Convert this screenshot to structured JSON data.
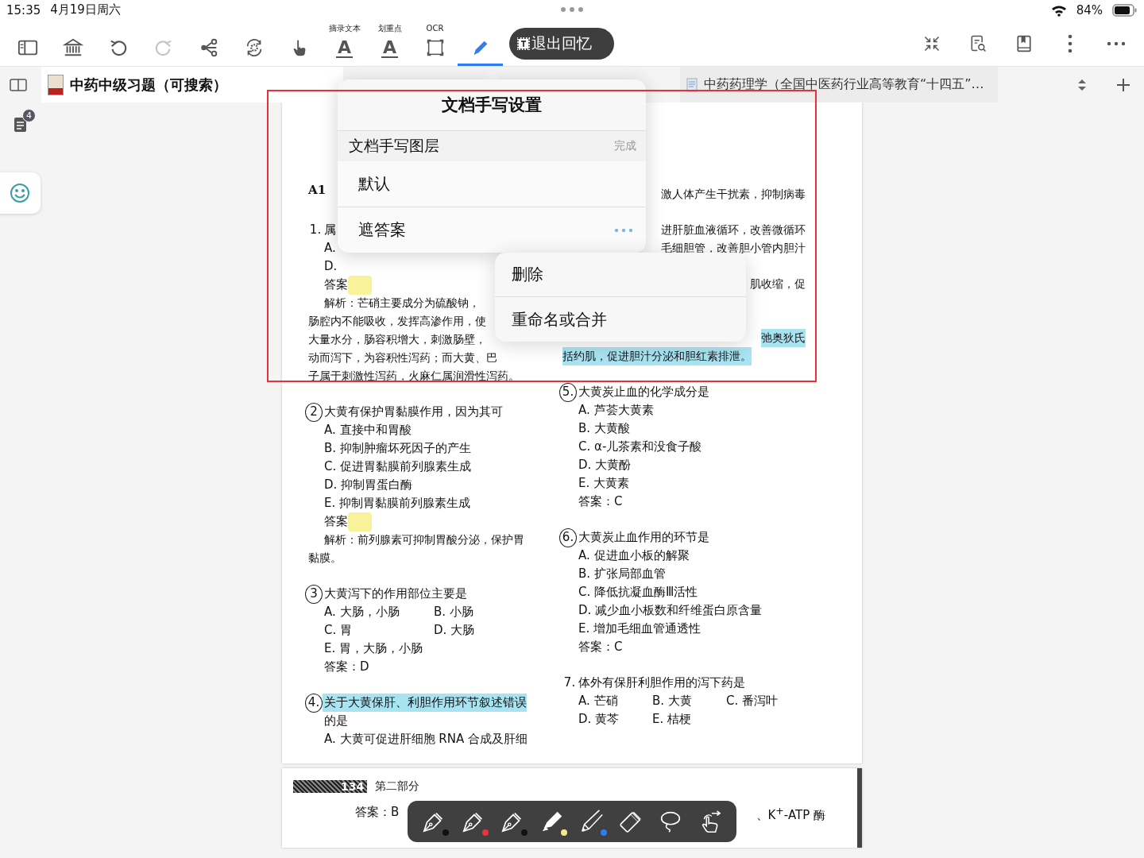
{
  "status_bar": {
    "time": "15:35",
    "date": "4月19日周六",
    "battery": "84%"
  },
  "toolbar": {
    "tools": [
      {
        "kind": "sidebar",
        "selected": false,
        "disabled": false
      },
      {
        "kind": "library",
        "selected": false,
        "disabled": false
      },
      {
        "kind": "undo",
        "selected": false,
        "disabled": false
      },
      {
        "kind": "redo",
        "selected": false,
        "disabled": true
      },
      {
        "kind": "share",
        "selected": false,
        "disabled": false
      },
      {
        "kind": "rotate",
        "selected": false,
        "disabled": false
      },
      {
        "kind": "hand",
        "selected": false,
        "disabled": false
      },
      {
        "kind": "letter",
        "label": "摘录文本",
        "glyph": "A",
        "selected": false,
        "disabled": false
      },
      {
        "kind": "letter",
        "label": "划重点",
        "glyph": "A",
        "selected": false,
        "disabled": false
      },
      {
        "kind": "scan",
        "label": "OCR",
        "selected": false,
        "disabled": false
      },
      {
        "kind": "pencil",
        "selected": true,
        "disabled": false
      }
    ],
    "exit_button": "退出回忆",
    "right_tools": [
      {
        "kind": "collapse"
      },
      {
        "kind": "doc-search"
      },
      {
        "kind": "bookmark"
      },
      {
        "kind": "kebab"
      },
      {
        "kind": "more"
      }
    ]
  },
  "tabs": [
    {
      "title": "中药中级习题（可搜索）",
      "selected": true
    },
    {
      "title": "中药药理学（全国中医药行业高等教育“十四五”…",
      "selected": false
    }
  ],
  "notes_badge": "4",
  "popup": {
    "title": "文档手写设置",
    "header": "文档手写图层",
    "done": "完成",
    "layers": [
      "默认",
      "遮答案"
    ]
  },
  "context_menu": [
    "删除",
    "重命名或合并"
  ],
  "document": {
    "left": [
      {
        "lines": [
          {
            "kind": "section",
            "text": "A1"
          }
        ]
      },
      {
        "lines": [
          {
            "kind": "stem",
            "number": "1.",
            "text": "属",
            "circled": false,
            "highlighted": false
          },
          {
            "kind": "option",
            "text": "A."
          },
          {
            "kind": "option",
            "text": "D."
          },
          {
            "kind": "answer",
            "text": "答案",
            "masked": true
          },
          {
            "kind": "analysis",
            "text": "解析：芒硝主要成分为硫酸钠，"
          },
          {
            "kind": "cont",
            "text": "肠腔内不能吸收，发挥高渗作用，使"
          },
          {
            "kind": "cont",
            "text": "大量水分，肠容积增大，刺激肠壁，"
          },
          {
            "kind": "cont",
            "text": "动而泻下，为容积性泻药；而大黄、巴"
          },
          {
            "kind": "cont",
            "text": "子属于刺激性泻药，火麻仁属润滑性泻药。"
          }
        ]
      },
      {
        "lines": [
          {
            "kind": "stem",
            "number": "2",
            "text": "大黄有保护胃黏膜作用，因为其可",
            "circled": true,
            "highlighted": false
          },
          {
            "kind": "option",
            "text": "A. 直接中和胃酸"
          },
          {
            "kind": "option",
            "text": "B. 抑制肿瘤坏死因子的产生"
          },
          {
            "kind": "option",
            "text": "C. 促进胃黏膜前列腺素生成"
          },
          {
            "kind": "option",
            "text": "D. 抑制胃蛋白酶"
          },
          {
            "kind": "option",
            "text": "E. 抑制胃黏膜前列腺素生成"
          },
          {
            "kind": "answer",
            "text": "答案",
            "masked": true
          },
          {
            "kind": "analysis",
            "text": "解析：前列腺素可抑制胃酸分泌，保护胃"
          },
          {
            "kind": "cont",
            "text": "黏膜。"
          }
        ]
      },
      {
        "lines": [
          {
            "kind": "stem",
            "number": "3",
            "text": "大黄泻下的作用部位主要是",
            "circled": true,
            "highlighted": false
          },
          {
            "kind": "row",
            "items": [
              "A. 大肠，小肠",
              "B. 小肠"
            ]
          },
          {
            "kind": "row",
            "items": [
              "C. 胃",
              "D. 大肠"
            ]
          },
          {
            "kind": "option",
            "text": "E. 胃，大肠，小肠"
          },
          {
            "kind": "answer",
            "text": "答案：D",
            "masked": false
          }
        ]
      },
      {
        "lines": [
          {
            "kind": "stem",
            "number": "4.",
            "text": "关于大黄保肝、利胆作用环节叙述错误",
            "circled": true,
            "highlighted": true
          },
          {
            "kind": "option",
            "text": "的是"
          },
          {
            "kind": "option",
            "text": "A. 大黄可促进肝细胞 RNA 合成及肝细"
          }
        ]
      }
    ],
    "right": [
      {
        "lines": [
          {
            "kind": "tail",
            "text": "激人体产生干扰素，抑制病毒",
            "highlighted": false
          }
        ]
      },
      {
        "lines": [
          {
            "kind": "tail",
            "text": "进肝脏血液循环，改善微循环",
            "highlighted": false
          },
          {
            "kind": "tail",
            "text": "毛细胆管，改善胆小管内胆汁",
            "highlighted": false
          }
        ]
      },
      {
        "lines": [
          {
            "kind": "tail",
            "text": "肌收缩，促",
            "highlighted": false
          }
        ]
      },
      {
        "lines": [
          {
            "kind": "tail",
            "text": "弛奥狄氏",
            "highlighted": true
          },
          {
            "kind": "cont",
            "text": "括约肌，促进胆汁分泌和胆红素排泄。",
            "highlighted": true
          }
        ]
      },
      {
        "lines": [
          {
            "kind": "stem",
            "number": "5.",
            "text": "大黄炭止血的化学成分是",
            "circled": true,
            "highlighted": false
          },
          {
            "kind": "option",
            "text": "A. 芦荟大黄素"
          },
          {
            "kind": "option",
            "text": "B. 大黄酸"
          },
          {
            "kind": "option",
            "text": "C. α-儿茶素和没食子酸"
          },
          {
            "kind": "option",
            "text": "D. 大黄酚"
          },
          {
            "kind": "option",
            "text": "E. 大黄素"
          },
          {
            "kind": "answer",
            "text": "答案：C",
            "masked": false
          }
        ]
      },
      {
        "lines": [
          {
            "kind": "stem",
            "number": "6.",
            "text": "大黄炭止血作用的环节是",
            "circled": true,
            "highlighted": false
          },
          {
            "kind": "option",
            "text": "A. 促进血小板的解聚"
          },
          {
            "kind": "option",
            "text": "B. 扩张局部血管"
          },
          {
            "kind": "option",
            "text": "C. 降低抗凝血酶Ⅲ活性"
          },
          {
            "kind": "option",
            "text": "D. 减少血小板数和纤维蛋白原含量"
          },
          {
            "kind": "option",
            "text": "E. 增加毛细血管通透性"
          },
          {
            "kind": "answer",
            "text": "答案：C",
            "masked": false
          }
        ]
      },
      {
        "lines": [
          {
            "kind": "stem",
            "number": "7.",
            "text": "体外有保肝利胆作用的泻下药是",
            "circled": false,
            "highlighted": false
          },
          {
            "kind": "row",
            "items": [
              "A. 芒硝",
              "B. 大黄",
              "C. 番泻叶"
            ]
          },
          {
            "kind": "row",
            "items": [
              "D. 黄芩",
              "E. 桔梗"
            ]
          }
        ]
      }
    ]
  },
  "next_page": {
    "page_number": "134",
    "section": "第二部分",
    "answer": "答案：B",
    "fragment": "、K$^{+}$-ATP 酶"
  },
  "pen_toolbar": [
    {
      "kind": "pen",
      "color": "#111111"
    },
    {
      "kind": "pen",
      "color": "#e8333b"
    },
    {
      "kind": "pen",
      "color": "#111111"
    },
    {
      "kind": "highlighter",
      "color": "#f4e98a"
    },
    {
      "kind": "pencil",
      "color": "#2f7df6"
    },
    {
      "kind": "eraser"
    },
    {
      "kind": "lasso"
    },
    {
      "kind": "gesture"
    }
  ]
}
